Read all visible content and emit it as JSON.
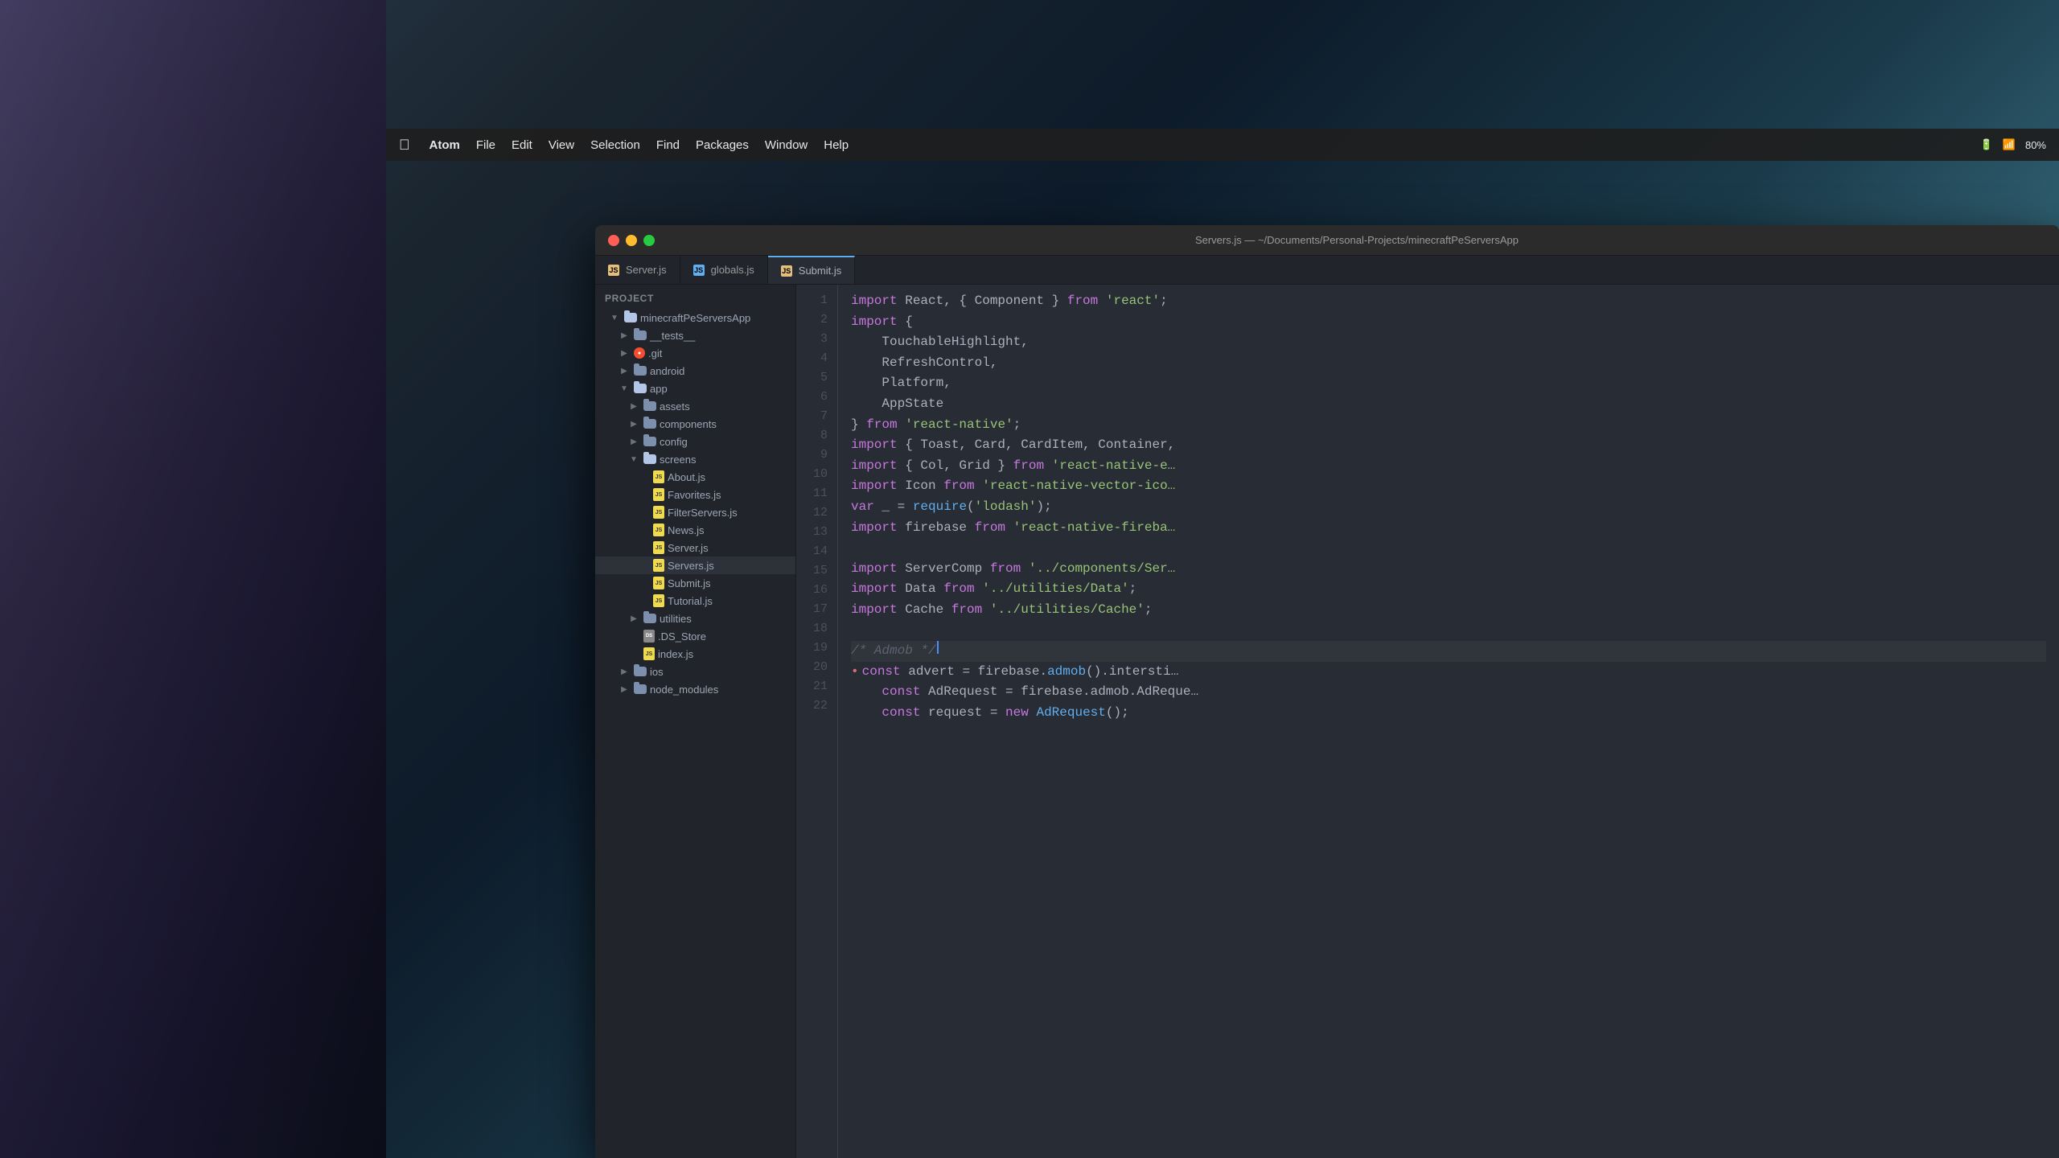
{
  "desktop": {
    "background_desc": "mountain landscape with teal sky"
  },
  "menubar": {
    "apple_symbol": "",
    "items": [
      "Atom",
      "File",
      "Edit",
      "View",
      "Selection",
      "Find",
      "Packages",
      "Window",
      "Help"
    ],
    "right_items": [
      "80%"
    ]
  },
  "window": {
    "title": "Servers.js — ~/Documents/Personal-Projects/minecraftPeServersApp",
    "controls": {
      "close": "close",
      "minimize": "minimize",
      "maximize": "maximize"
    }
  },
  "tabs": [
    {
      "label": "Server.js",
      "icon_type": "js",
      "active": false
    },
    {
      "label": "globals.js",
      "icon_type": "js",
      "active": false
    },
    {
      "label": "Submit.js",
      "icon_type": "js",
      "active": true
    }
  ],
  "file_tree": {
    "header": "Project",
    "items": [
      {
        "indent": 1,
        "type": "folder",
        "open": true,
        "name": "minecraftPeServersApp"
      },
      {
        "indent": 2,
        "type": "folder",
        "open": false,
        "name": "__tests__"
      },
      {
        "indent": 2,
        "type": "folder",
        "open": false,
        "name": ".git",
        "icon_type": "git"
      },
      {
        "indent": 2,
        "type": "folder",
        "open": false,
        "name": "android"
      },
      {
        "indent": 2,
        "type": "folder",
        "open": true,
        "name": "app"
      },
      {
        "indent": 3,
        "type": "folder",
        "open": false,
        "name": "assets"
      },
      {
        "indent": 3,
        "type": "folder",
        "open": false,
        "name": "components"
      },
      {
        "indent": 3,
        "type": "folder",
        "open": false,
        "name": "config"
      },
      {
        "indent": 3,
        "type": "folder",
        "open": true,
        "name": "screens"
      },
      {
        "indent": 4,
        "type": "file",
        "name": "About.js",
        "icon_type": "js"
      },
      {
        "indent": 4,
        "type": "file",
        "name": "Favorites.js",
        "icon_type": "js"
      },
      {
        "indent": 4,
        "type": "file",
        "name": "FilterServers.js",
        "icon_type": "js"
      },
      {
        "indent": 4,
        "type": "file",
        "name": "News.js",
        "icon_type": "js"
      },
      {
        "indent": 4,
        "type": "file",
        "name": "Server.js",
        "icon_type": "js"
      },
      {
        "indent": 4,
        "type": "file",
        "name": "Servers.js",
        "icon_type": "js",
        "selected": true
      },
      {
        "indent": 4,
        "type": "file",
        "name": "Submit.js",
        "icon_type": "js"
      },
      {
        "indent": 4,
        "type": "file",
        "name": "Tutorial.js",
        "icon_type": "js"
      },
      {
        "indent": 3,
        "type": "folder",
        "open": false,
        "name": "utilities"
      },
      {
        "indent": 3,
        "type": "file",
        "name": ".DS_Store",
        "icon_type": "ds"
      },
      {
        "indent": 3,
        "type": "file",
        "name": "index.js",
        "icon_type": "js"
      },
      {
        "indent": 2,
        "type": "folder",
        "open": false,
        "name": "ios"
      },
      {
        "indent": 2,
        "type": "folder",
        "open": false,
        "name": "node_modules"
      }
    ]
  },
  "code": {
    "filename": "Servers.js",
    "lines": [
      {
        "num": 1,
        "tokens": [
          {
            "type": "kw",
            "text": "import"
          },
          {
            "type": "plain",
            "text": " React, { Component } "
          },
          {
            "type": "kw",
            "text": "from"
          },
          {
            "type": "plain",
            "text": " "
          },
          {
            "type": "str",
            "text": "'react'"
          },
          {
            "type": "plain",
            "text": ";"
          }
        ]
      },
      {
        "num": 2,
        "tokens": [
          {
            "type": "kw",
            "text": "import"
          },
          {
            "type": "plain",
            "text": " {"
          }
        ]
      },
      {
        "num": 3,
        "tokens": [
          {
            "type": "plain",
            "text": "    TouchableHighlight,"
          }
        ]
      },
      {
        "num": 4,
        "tokens": [
          {
            "type": "plain",
            "text": "    RefreshControl,"
          }
        ]
      },
      {
        "num": 5,
        "tokens": [
          {
            "type": "plain",
            "text": "    Platform,"
          }
        ]
      },
      {
        "num": 6,
        "tokens": [
          {
            "type": "plain",
            "text": "    AppState"
          }
        ]
      },
      {
        "num": 7,
        "tokens": [
          {
            "type": "plain",
            "text": "} "
          },
          {
            "type": "kw",
            "text": "from"
          },
          {
            "type": "plain",
            "text": " "
          },
          {
            "type": "str",
            "text": "'react-native'"
          },
          {
            "type": "plain",
            "text": ";"
          }
        ]
      },
      {
        "num": 8,
        "tokens": [
          {
            "type": "kw",
            "text": "import"
          },
          {
            "type": "plain",
            "text": " { Toast, Card, CardItem, Container,"
          }
        ]
      },
      {
        "num": 9,
        "tokens": [
          {
            "type": "kw",
            "text": "import"
          },
          {
            "type": "plain",
            "text": " { Col, Grid } "
          },
          {
            "type": "kw",
            "text": "from"
          },
          {
            "type": "plain",
            "text": " "
          },
          {
            "type": "str",
            "text": "'react-native-e"
          },
          {
            "type": "plain",
            "text": "…"
          }
        ]
      },
      {
        "num": 10,
        "tokens": [
          {
            "type": "kw",
            "text": "import"
          },
          {
            "type": "plain",
            "text": " Icon "
          },
          {
            "type": "kw",
            "text": "from"
          },
          {
            "type": "plain",
            "text": " "
          },
          {
            "type": "str",
            "text": "'react-native-vector-ico"
          },
          {
            "type": "plain",
            "text": "…"
          }
        ]
      },
      {
        "num": 11,
        "tokens": [
          {
            "type": "kw",
            "text": "var"
          },
          {
            "type": "plain",
            "text": " _ = "
          },
          {
            "type": "fn",
            "text": "require"
          },
          {
            "type": "plain",
            "text": "("
          },
          {
            "type": "str",
            "text": "'lodash'"
          },
          {
            "type": "plain",
            "text": ");"
          }
        ]
      },
      {
        "num": 12,
        "tokens": [
          {
            "type": "kw",
            "text": "import"
          },
          {
            "type": "plain",
            "text": " firebase "
          },
          {
            "type": "kw",
            "text": "from"
          },
          {
            "type": "plain",
            "text": " "
          },
          {
            "type": "str",
            "text": "'react-native-fireba"
          },
          {
            "type": "plain",
            "text": "…"
          }
        ]
      },
      {
        "num": 13,
        "tokens": []
      },
      {
        "num": 14,
        "tokens": [
          {
            "type": "kw",
            "text": "import"
          },
          {
            "type": "plain",
            "text": " ServerComp "
          },
          {
            "type": "kw",
            "text": "from"
          },
          {
            "type": "plain",
            "text": " "
          },
          {
            "type": "str",
            "text": "'../components/Ser"
          },
          {
            "type": "plain",
            "text": "…"
          }
        ]
      },
      {
        "num": 15,
        "tokens": [
          {
            "type": "kw",
            "text": "import"
          },
          {
            "type": "plain",
            "text": " Data "
          },
          {
            "type": "kw",
            "text": "from"
          },
          {
            "type": "plain",
            "text": " "
          },
          {
            "type": "str",
            "text": "'../utilities/Data'"
          },
          {
            "type": "plain",
            "text": ";"
          }
        ]
      },
      {
        "num": 16,
        "tokens": [
          {
            "type": "kw",
            "text": "import"
          },
          {
            "type": "plain",
            "text": " Cache "
          },
          {
            "type": "kw",
            "text": "from"
          },
          {
            "type": "plain",
            "text": " "
          },
          {
            "type": "str",
            "text": "'../utilities/Cache'"
          },
          {
            "type": "plain",
            "text": ";"
          }
        ]
      },
      {
        "num": 17,
        "tokens": []
      },
      {
        "num": 18,
        "tokens": [
          {
            "type": "comment",
            "text": "/* Admob */"
          },
          {
            "type": "cursor",
            "text": ""
          }
        ],
        "is_cursor": true
      },
      {
        "num": 19,
        "tokens": [
          {
            "type": "dot",
            "text": "•"
          },
          {
            "type": "kw",
            "text": "const"
          },
          {
            "type": "plain",
            "text": " advert = firebase."
          },
          {
            "type": "fn",
            "text": "admob"
          },
          {
            "type": "plain",
            "text": "().intersti…"
          }
        ]
      },
      {
        "num": 20,
        "tokens": [
          {
            "type": "plain",
            "text": "    "
          },
          {
            "type": "kw",
            "text": "const"
          },
          {
            "type": "plain",
            "text": " AdRequest = firebase.admob.AdReque…"
          }
        ]
      },
      {
        "num": 21,
        "tokens": [
          {
            "type": "plain",
            "text": "    "
          },
          {
            "type": "kw",
            "text": "const"
          },
          {
            "type": "plain",
            "text": " request = "
          },
          {
            "type": "kw",
            "text": "new"
          },
          {
            "type": "plain",
            "text": " "
          },
          {
            "type": "fn",
            "text": "AdRequest"
          },
          {
            "type": "plain",
            "text": "();"
          }
        ]
      },
      {
        "num": 22,
        "tokens": []
      }
    ]
  }
}
